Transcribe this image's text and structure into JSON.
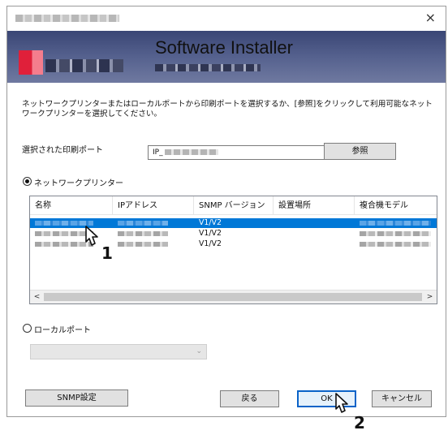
{
  "window": {
    "close_label": "×"
  },
  "banner": {
    "title": "Software Installer"
  },
  "description": "ネットワークプリンターまたはローカルポートから印刷ポートを選択するか、[参照]をクリックして利用可能なネットワークプリンターを選択してください。",
  "port": {
    "label": "選択された印刷ポート",
    "value": "IP_",
    "browse_label": "参照"
  },
  "network_option": {
    "label": "ネットワークプリンター",
    "selected": true
  },
  "table": {
    "columns": [
      "名称",
      "IPアドレス",
      "SNMP バージョン",
      "設置場所",
      "複合機モデル"
    ],
    "rows": [
      {
        "snmp": "V1/V2",
        "selected": true
      },
      {
        "snmp": "V1/V2",
        "selected": false
      },
      {
        "snmp": "V1/V2",
        "selected": false
      }
    ],
    "scroll_left": "<",
    "scroll_right": ">"
  },
  "local_option": {
    "label": "ローカルポート",
    "selected": false
  },
  "buttons": {
    "snmp": "SNMP設定",
    "back": "戻る",
    "ok": "OK",
    "cancel": "キャンセル"
  },
  "annotations": {
    "step1": "1",
    "step2": "2"
  },
  "colors": {
    "selection": "#0078d7",
    "banner": "#4a5583"
  }
}
